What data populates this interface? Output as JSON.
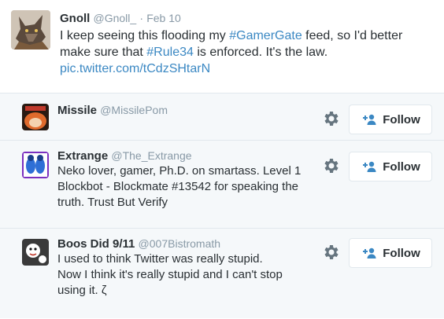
{
  "tweet": {
    "name": "Gnoll",
    "handle": "@Gnoll_",
    "separator": "·",
    "time": "Feb 10",
    "text_1": "I keep seeing this flooding my ",
    "hashtag_1": "#GamerGate",
    "text_2": " feed, so I'd better make sure that ",
    "hashtag_2": "#Rule34",
    "text_3": " is enforced. It's the law.",
    "link": "pic.twitter.com/tCdzSHtarN"
  },
  "suggestions": [
    {
      "name": "Missile",
      "handle": "@MissilePom",
      "bio": "",
      "follow_label": "Follow"
    },
    {
      "name": "Extrange",
      "handle": "@The_Extrange",
      "bio": "Neko lover, gamer, Ph.D. on smartass. Level 1 Blockbot - Blockmate #13542 for speaking the truth. Trust But Verify",
      "follow_label": "Follow"
    },
    {
      "name": "Boos Did 9/11",
      "handle": "@007Bistromath",
      "bio": "I used to think Twitter was really stupid. Now I think it's really stupid and I can't stop using it. ζ",
      "follow_label": "Follow"
    }
  ],
  "colors": {
    "link": "#3b88c3",
    "muted": "#8899a6",
    "border": "#e1e8ed",
    "panel_bg": "#f5f8fa"
  },
  "icons": {
    "settings": "gear-icon",
    "follow": "add-person-icon"
  }
}
